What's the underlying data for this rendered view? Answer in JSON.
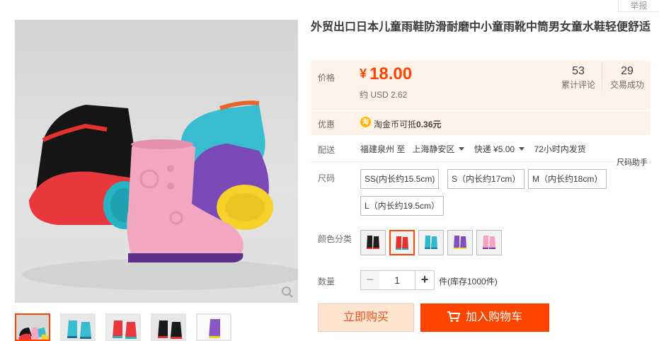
{
  "report_link": "举报",
  "product": {
    "title": "外贸出口日本儿童雨鞋防滑耐磨中小童雨靴中筒男女童水鞋轻便舒适"
  },
  "price": {
    "label": "价格",
    "currency": "¥",
    "value": "18.00",
    "usd": "约 USD 2.62"
  },
  "stats": {
    "reviews_count": "53",
    "reviews_label": "累计评论",
    "trades_count": "29",
    "trades_label": "交易成功"
  },
  "promo": {
    "label": "优惠",
    "coin_icon_text": "淘",
    "text_prefix": "淘金币可抵",
    "amount": "0.36元"
  },
  "shipping": {
    "label": "配送",
    "from": "福建泉州 至",
    "to": "上海静安区",
    "method": "快递 ¥5.00",
    "dispatch": "72小时内发货"
  },
  "size": {
    "label": "尺码",
    "helper": "尺码助手",
    "options": [
      "SS(内长约15.5cm)",
      "S（内长约17cm）",
      "M（内长约18cm）",
      "L（内长约19.5cm）"
    ]
  },
  "color": {
    "label": "颜色分类",
    "options": [
      {
        "name": "black",
        "hex": "#1e1e1e",
        "accent": "#e5322d"
      },
      {
        "name": "red",
        "hex": "#e5322d",
        "accent": "#1fb1c2"
      },
      {
        "name": "teal",
        "hex": "#31b9cd",
        "accent": "#2f6f9a"
      },
      {
        "name": "purple",
        "hex": "#8050c0",
        "accent": "#f2d22a"
      },
      {
        "name": "pink",
        "hex": "#f5a3c0",
        "accent": "#6b3a9d"
      }
    ],
    "selected": "red"
  },
  "quantity": {
    "label": "数量",
    "minus": "−",
    "value": "1",
    "plus": "+",
    "stock": "件(库存1000件)"
  },
  "actions": {
    "buy_now": "立即购买",
    "add_to_cart": "加入购物车"
  },
  "colors": {
    "accent": "#ff4400",
    "price": "#ff4400",
    "panel_bg": "#fff2e8"
  },
  "icons": {
    "zoom": "magnifier-icon",
    "cart": "cart-icon",
    "coin": "taobao-coin-icon",
    "caret": "caret-down-icon"
  }
}
